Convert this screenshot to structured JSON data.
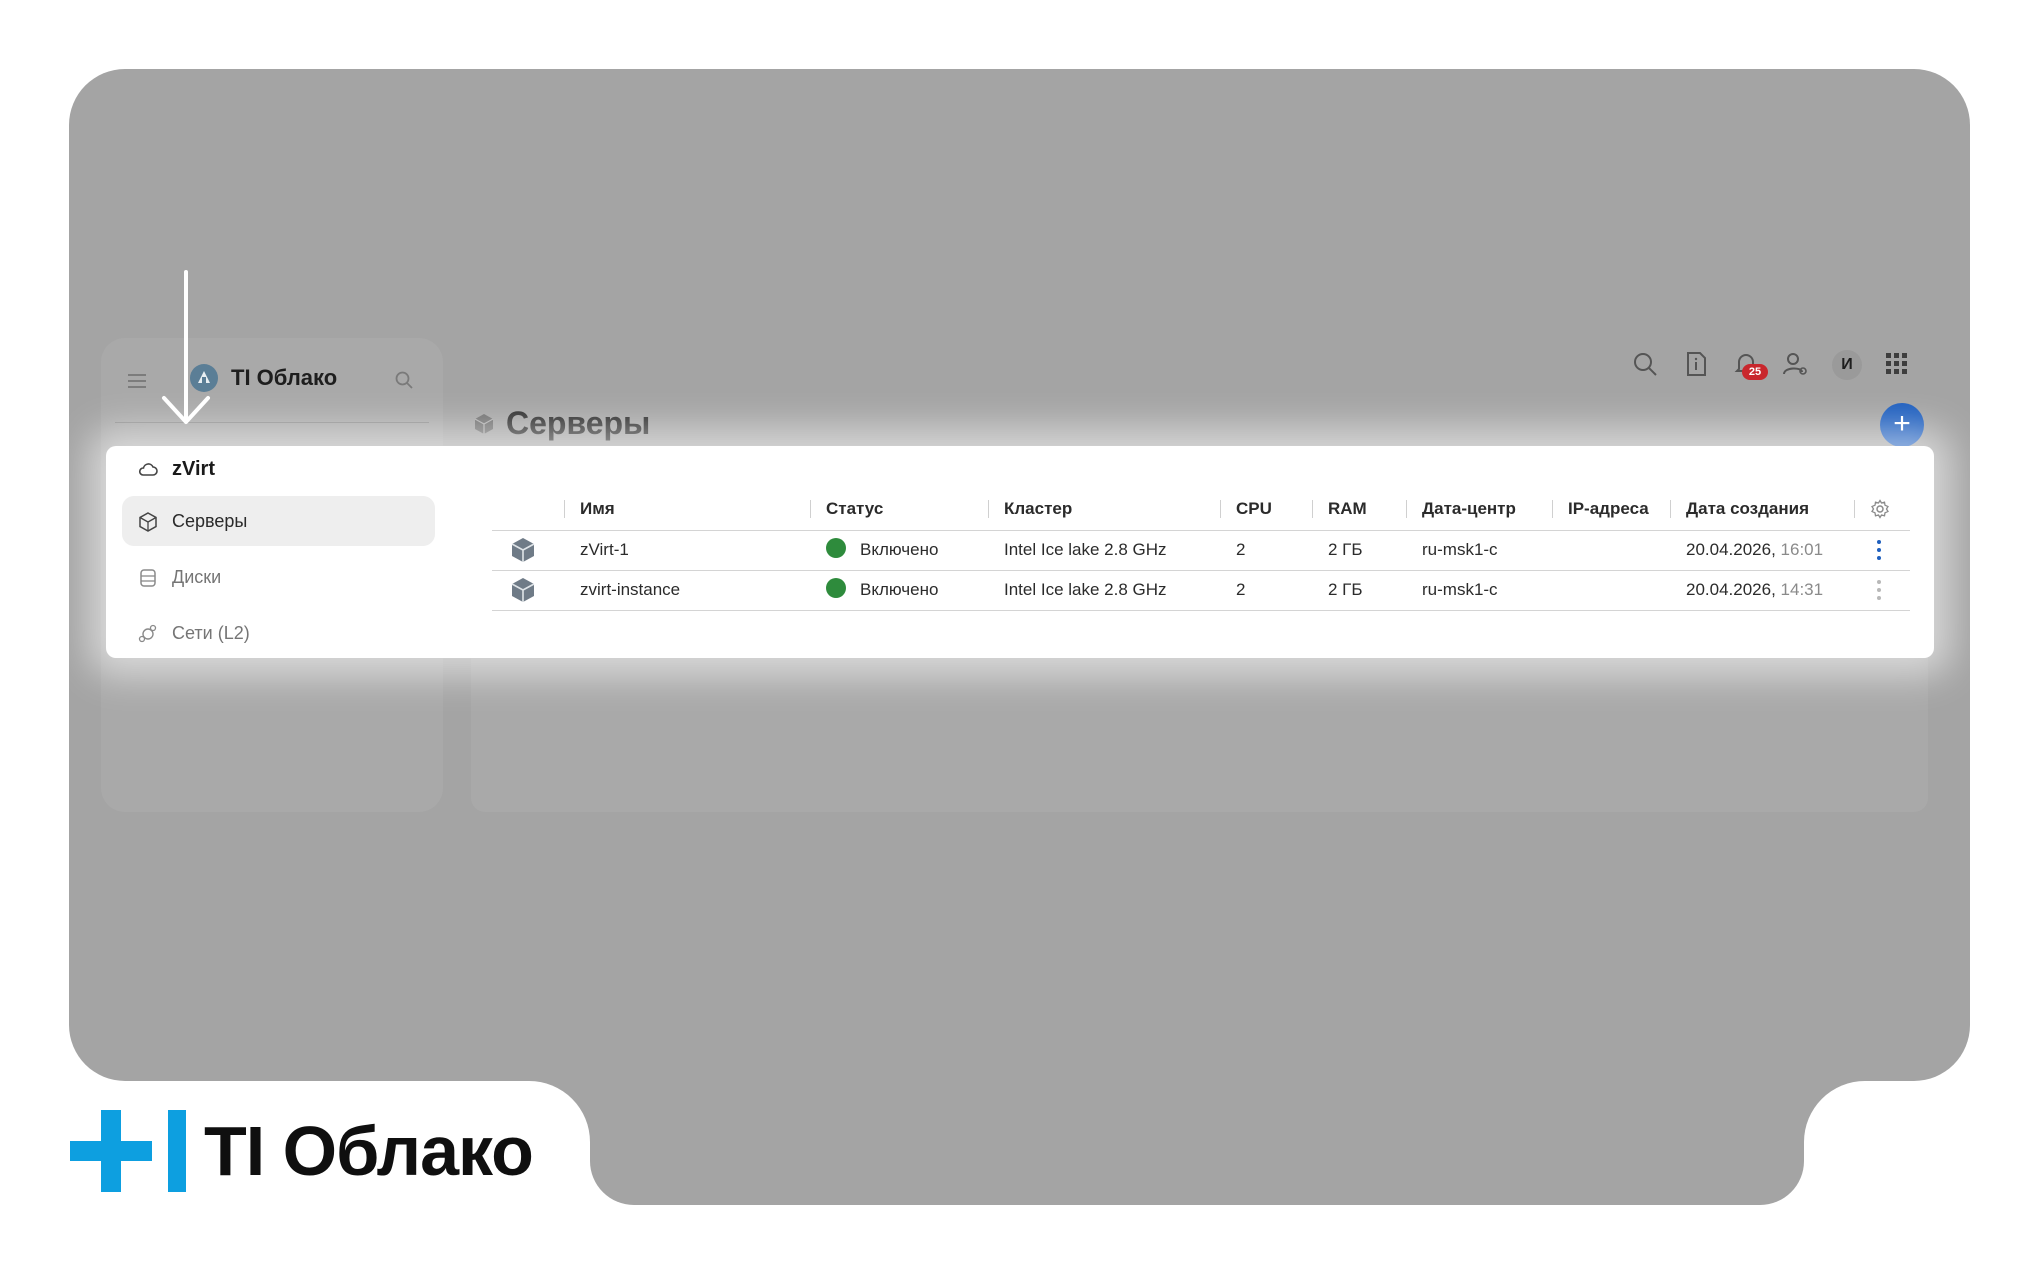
{
  "brand": {
    "name": "TI Облако",
    "accent_color": "#0d9fe0"
  },
  "sidebar": {
    "section_title": "zVirt",
    "items": [
      {
        "label": "Серверы",
        "icon": "cube-icon",
        "active": true
      },
      {
        "label": "Диски",
        "icon": "disk-icon",
        "active": false
      },
      {
        "label": "Сети (L2)",
        "icon": "network-icon",
        "active": false
      }
    ]
  },
  "header": {
    "notification_count": "25",
    "user_initial": "И"
  },
  "page": {
    "title": "Серверы"
  },
  "table": {
    "columns": [
      "Имя",
      "Статус",
      "Кластер",
      "CPU",
      "RAM",
      "Дата-центр",
      "IP-адреса",
      "Дата создания"
    ],
    "rows": [
      {
        "name": "zVirt-1",
        "status": "Включено",
        "status_color": "#2e8b3c",
        "cluster": "Intel Ice lake 2.8 GHz",
        "cpu": "2",
        "ram": "2 ГБ",
        "datacenter": "ru-msk1-c",
        "ip": "",
        "created_date": "20.04.2026,",
        "created_time": "16:01"
      },
      {
        "name": "zvirt-instance",
        "status": "Включено",
        "status_color": "#2e8b3c",
        "cluster": "Intel Ice lake 2.8 GHz",
        "cpu": "2",
        "ram": "2 ГБ",
        "datacenter": "ru-msk1-c",
        "ip": "",
        "created_date": "20.04.2026,",
        "created_time": "14:31"
      }
    ]
  },
  "footer_logo": {
    "text": "TI Облако"
  },
  "colors": {
    "backdrop": "#a4a4a4",
    "primary_button": "#1f5fbe",
    "badge": "#c9272d"
  }
}
